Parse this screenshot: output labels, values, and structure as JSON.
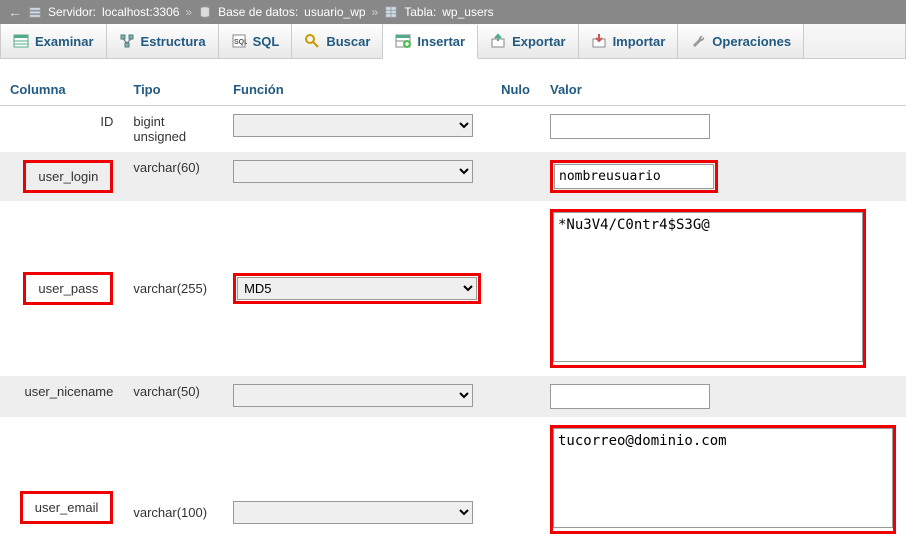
{
  "breadcrumb": {
    "server_label": "Servidor:",
    "server_value": "localhost:3306",
    "db_label": "Base de datos:",
    "db_value": "usuario_wp",
    "table_label": "Tabla:",
    "table_value": "wp_users"
  },
  "tabs": {
    "examinar": "Examinar",
    "estructura": "Estructura",
    "sql": "SQL",
    "buscar": "Buscar",
    "insertar": "Insertar",
    "exportar": "Exportar",
    "importar": "Importar",
    "operaciones": "Operaciones"
  },
  "headers": {
    "columna": "Columna",
    "tipo": "Tipo",
    "funcion": "Función",
    "nulo": "Nulo",
    "valor": "Valor"
  },
  "rows": {
    "id": {
      "name": "ID",
      "type": "bigint unsigned",
      "func": "",
      "value": ""
    },
    "user_login": {
      "name": "user_login",
      "type": "varchar(60)",
      "func": "",
      "value": "nombreusuario"
    },
    "user_pass": {
      "name": "user_pass",
      "type": "varchar(255)",
      "func": "MD5",
      "value": "*Nu3V4/C0ntr4$S3G@"
    },
    "user_nicename": {
      "name": "user_nicename",
      "type": "varchar(50)",
      "func": "",
      "value": ""
    },
    "user_email": {
      "name": "user_email",
      "type": "varchar(100)",
      "func": "",
      "value": "tucorreo@dominio.com"
    }
  }
}
